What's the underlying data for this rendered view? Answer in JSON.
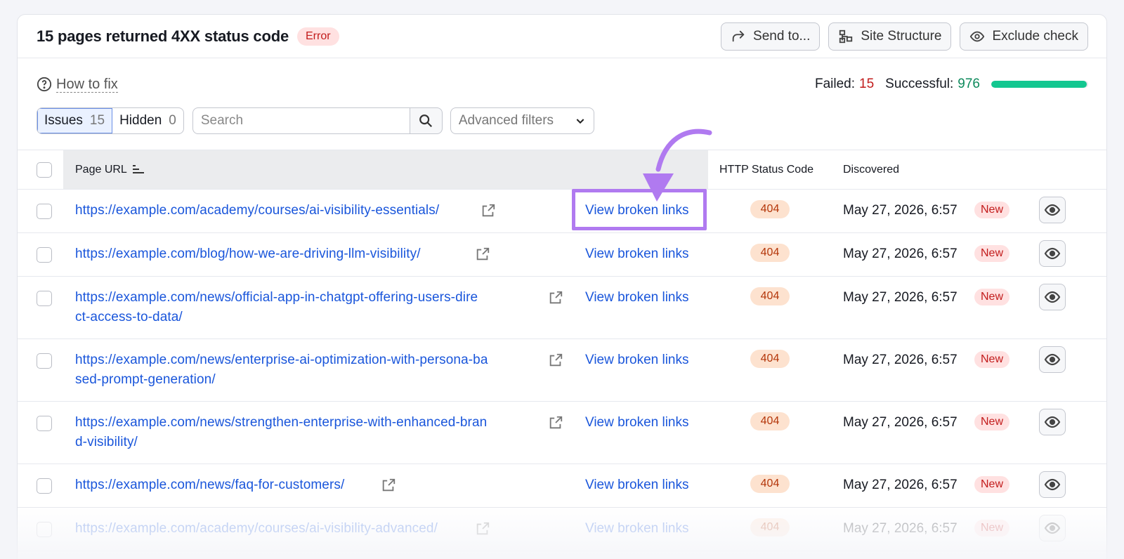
{
  "header": {
    "title": "15 pages returned 4XX status code",
    "badge": "Error",
    "actions": [
      {
        "label": "Send to...",
        "icon": "share-arrow-icon"
      },
      {
        "label": "Site Structure",
        "icon": "sitemap-icon"
      },
      {
        "label": "Exclude check",
        "icon": "eye-icon"
      }
    ]
  },
  "how_to_fix": "How to fix",
  "stats": {
    "failed_label": "Failed:",
    "failed_value": "15",
    "successful_label": "Successful:",
    "successful_value": "976",
    "progress_fraction": 0.985,
    "colors": {
      "failed": "#c21c1c",
      "successful": "#0e8a5c",
      "bar": "#13c790"
    }
  },
  "filters": {
    "issues_label": "Issues",
    "issues_count": "15",
    "hidden_label": "Hidden",
    "hidden_count": "0",
    "search_placeholder": "Search",
    "advanced_label": "Advanced filters"
  },
  "table": {
    "columns": [
      "Page URL",
      "HTTP Status Code",
      "Discovered"
    ],
    "rows": [
      {
        "url": "https://example.com/academy/courses/ai-visibility-essentials/",
        "action": "View broken links",
        "code": "404",
        "date": "May 27, 2026, 6:57",
        "tag": "New"
      },
      {
        "url": "https://example.com/blog/how-we-are-driving-llm-visibility/",
        "action": "View broken links",
        "code": "404",
        "date": "May 27, 2026, 6:57",
        "tag": "New"
      },
      {
        "url": "https://example.com/news/official-app-in-chatgpt-offering-users-dire",
        "url2": "ct-access-to-data/",
        "action": "View broken links",
        "code": "404",
        "date": "May 27, 2026, 6:57",
        "tag": "New"
      },
      {
        "url": "https://example.com/news/enterprise-ai-optimization-with-persona-ba",
        "url2": "sed-prompt-generation/",
        "action": "View broken links",
        "code": "404",
        "date": "May 27, 2026, 6:57",
        "tag": "New"
      },
      {
        "url": "https://example.com/news/strengthen-enterprise-with-enhanced-bran",
        "url2": "d-visibility/",
        "action": "View broken links",
        "code": "404",
        "date": "May 27, 2026, 6:57",
        "tag": "New"
      },
      {
        "url": "https://example.com/news/faq-for-customers/",
        "action": "View broken links",
        "code": "404",
        "date": "May 27, 2026, 6:57",
        "tag": "New"
      },
      {
        "url": "https://example.com/academy/courses/ai-visibility-advanced/",
        "action": "View broken links",
        "code": "404",
        "date": "May 27, 2026, 6:57",
        "tag": "New"
      }
    ]
  }
}
